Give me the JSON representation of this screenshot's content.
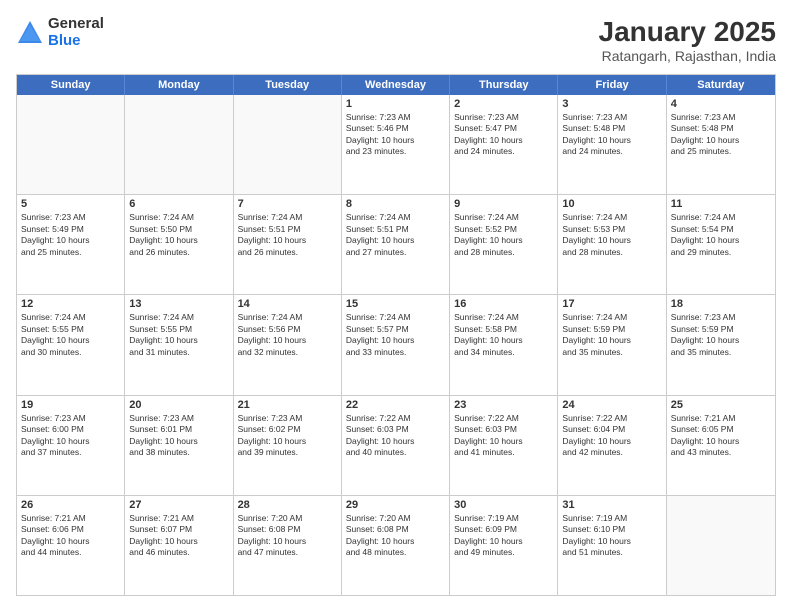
{
  "logo": {
    "general": "General",
    "blue": "Blue"
  },
  "title": "January 2025",
  "subtitle": "Ratangarh, Rajasthan, India",
  "days": [
    "Sunday",
    "Monday",
    "Tuesday",
    "Wednesday",
    "Thursday",
    "Friday",
    "Saturday"
  ],
  "rows": [
    [
      {
        "day": "",
        "info": ""
      },
      {
        "day": "",
        "info": ""
      },
      {
        "day": "",
        "info": ""
      },
      {
        "day": "1",
        "info": "Sunrise: 7:23 AM\nSunset: 5:46 PM\nDaylight: 10 hours\nand 23 minutes."
      },
      {
        "day": "2",
        "info": "Sunrise: 7:23 AM\nSunset: 5:47 PM\nDaylight: 10 hours\nand 24 minutes."
      },
      {
        "day": "3",
        "info": "Sunrise: 7:23 AM\nSunset: 5:48 PM\nDaylight: 10 hours\nand 24 minutes."
      },
      {
        "day": "4",
        "info": "Sunrise: 7:23 AM\nSunset: 5:48 PM\nDaylight: 10 hours\nand 25 minutes."
      }
    ],
    [
      {
        "day": "5",
        "info": "Sunrise: 7:23 AM\nSunset: 5:49 PM\nDaylight: 10 hours\nand 25 minutes."
      },
      {
        "day": "6",
        "info": "Sunrise: 7:24 AM\nSunset: 5:50 PM\nDaylight: 10 hours\nand 26 minutes."
      },
      {
        "day": "7",
        "info": "Sunrise: 7:24 AM\nSunset: 5:51 PM\nDaylight: 10 hours\nand 26 minutes."
      },
      {
        "day": "8",
        "info": "Sunrise: 7:24 AM\nSunset: 5:51 PM\nDaylight: 10 hours\nand 27 minutes."
      },
      {
        "day": "9",
        "info": "Sunrise: 7:24 AM\nSunset: 5:52 PM\nDaylight: 10 hours\nand 28 minutes."
      },
      {
        "day": "10",
        "info": "Sunrise: 7:24 AM\nSunset: 5:53 PM\nDaylight: 10 hours\nand 28 minutes."
      },
      {
        "day": "11",
        "info": "Sunrise: 7:24 AM\nSunset: 5:54 PM\nDaylight: 10 hours\nand 29 minutes."
      }
    ],
    [
      {
        "day": "12",
        "info": "Sunrise: 7:24 AM\nSunset: 5:55 PM\nDaylight: 10 hours\nand 30 minutes."
      },
      {
        "day": "13",
        "info": "Sunrise: 7:24 AM\nSunset: 5:55 PM\nDaylight: 10 hours\nand 31 minutes."
      },
      {
        "day": "14",
        "info": "Sunrise: 7:24 AM\nSunset: 5:56 PM\nDaylight: 10 hours\nand 32 minutes."
      },
      {
        "day": "15",
        "info": "Sunrise: 7:24 AM\nSunset: 5:57 PM\nDaylight: 10 hours\nand 33 minutes."
      },
      {
        "day": "16",
        "info": "Sunrise: 7:24 AM\nSunset: 5:58 PM\nDaylight: 10 hours\nand 34 minutes."
      },
      {
        "day": "17",
        "info": "Sunrise: 7:24 AM\nSunset: 5:59 PM\nDaylight: 10 hours\nand 35 minutes."
      },
      {
        "day": "18",
        "info": "Sunrise: 7:23 AM\nSunset: 5:59 PM\nDaylight: 10 hours\nand 35 minutes."
      }
    ],
    [
      {
        "day": "19",
        "info": "Sunrise: 7:23 AM\nSunset: 6:00 PM\nDaylight: 10 hours\nand 37 minutes."
      },
      {
        "day": "20",
        "info": "Sunrise: 7:23 AM\nSunset: 6:01 PM\nDaylight: 10 hours\nand 38 minutes."
      },
      {
        "day": "21",
        "info": "Sunrise: 7:23 AM\nSunset: 6:02 PM\nDaylight: 10 hours\nand 39 minutes."
      },
      {
        "day": "22",
        "info": "Sunrise: 7:22 AM\nSunset: 6:03 PM\nDaylight: 10 hours\nand 40 minutes."
      },
      {
        "day": "23",
        "info": "Sunrise: 7:22 AM\nSunset: 6:03 PM\nDaylight: 10 hours\nand 41 minutes."
      },
      {
        "day": "24",
        "info": "Sunrise: 7:22 AM\nSunset: 6:04 PM\nDaylight: 10 hours\nand 42 minutes."
      },
      {
        "day": "25",
        "info": "Sunrise: 7:21 AM\nSunset: 6:05 PM\nDaylight: 10 hours\nand 43 minutes."
      }
    ],
    [
      {
        "day": "26",
        "info": "Sunrise: 7:21 AM\nSunset: 6:06 PM\nDaylight: 10 hours\nand 44 minutes."
      },
      {
        "day": "27",
        "info": "Sunrise: 7:21 AM\nSunset: 6:07 PM\nDaylight: 10 hours\nand 46 minutes."
      },
      {
        "day": "28",
        "info": "Sunrise: 7:20 AM\nSunset: 6:08 PM\nDaylight: 10 hours\nand 47 minutes."
      },
      {
        "day": "29",
        "info": "Sunrise: 7:20 AM\nSunset: 6:08 PM\nDaylight: 10 hours\nand 48 minutes."
      },
      {
        "day": "30",
        "info": "Sunrise: 7:19 AM\nSunset: 6:09 PM\nDaylight: 10 hours\nand 49 minutes."
      },
      {
        "day": "31",
        "info": "Sunrise: 7:19 AM\nSunset: 6:10 PM\nDaylight: 10 hours\nand 51 minutes."
      },
      {
        "day": "",
        "info": ""
      }
    ]
  ]
}
